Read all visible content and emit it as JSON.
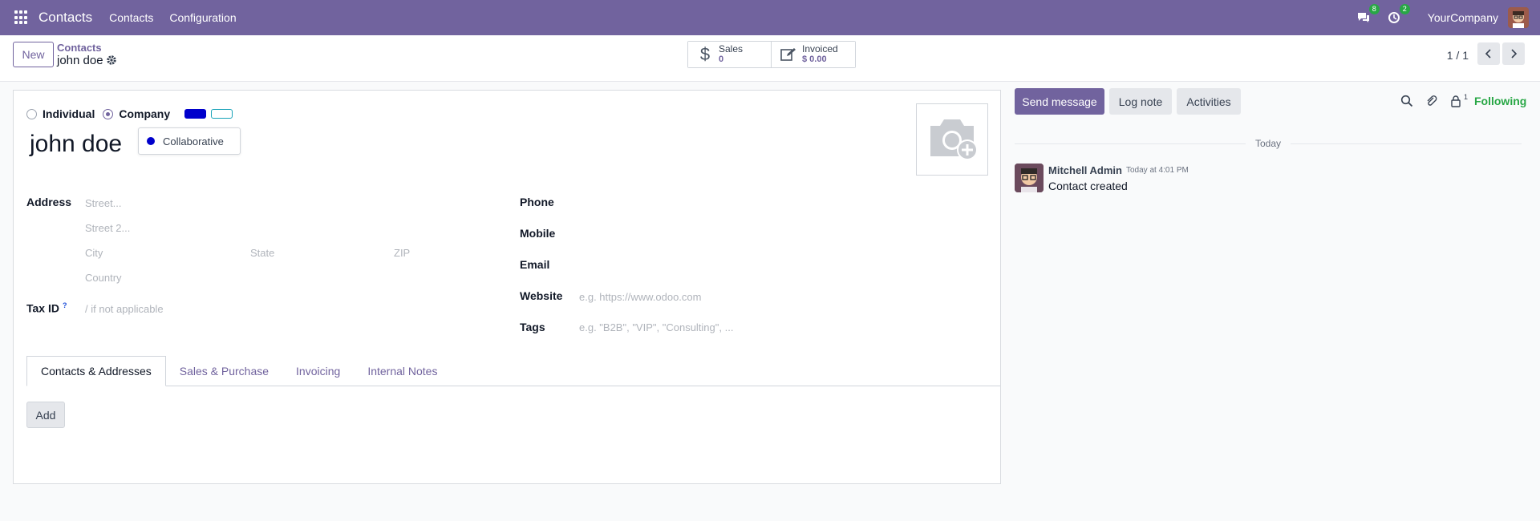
{
  "navbar": {
    "app_name": "Contacts",
    "menu": [
      "Contacts",
      "Configuration"
    ],
    "messages_count": "8",
    "activities_count": "2",
    "company": "YourCompany"
  },
  "control": {
    "new_label": "New",
    "breadcrumb": "Contacts",
    "record_title": "john doe",
    "sales_label": "Sales",
    "sales_value": "0",
    "invoiced_label": "Invoiced",
    "invoiced_value": "$ 0.00",
    "pager": "1 / 1"
  },
  "form": {
    "type_options": [
      "Individual",
      "Company"
    ],
    "selected_type": "Company",
    "name": "john doe",
    "color_tooltip": "Collaborative",
    "colors": {
      "accent": "#71639e",
      "selected_color": "#0000cc",
      "alt_color": "#17a2b8"
    },
    "address_label": "Address",
    "street_placeholder": "Street...",
    "street2_placeholder": "Street 2...",
    "city_placeholder": "City",
    "state_placeholder": "State",
    "zip_placeholder": "ZIP",
    "country_placeholder": "Country",
    "tax_label": "Tax ID",
    "tax_help": "?",
    "tax_placeholder": "/ if not applicable",
    "phone_label": "Phone",
    "mobile_label": "Mobile",
    "email_label": "Email",
    "website_label": "Website",
    "website_placeholder": "e.g. https://www.odoo.com",
    "tags_label": "Tags",
    "tags_placeholder": "e.g. \"B2B\", \"VIP\", \"Consulting\", ..."
  },
  "tabs": [
    "Contacts & Addresses",
    "Sales & Purchase",
    "Invoicing",
    "Internal Notes"
  ],
  "add_label": "Add",
  "chatter": {
    "send_message": "Send message",
    "log_note": "Log note",
    "activities": "Activities",
    "followers_count": "1",
    "following": "Following",
    "today": "Today",
    "message": {
      "author": "Mitchell Admin",
      "time": "Today at 4:01 PM",
      "body": "Contact created"
    }
  }
}
